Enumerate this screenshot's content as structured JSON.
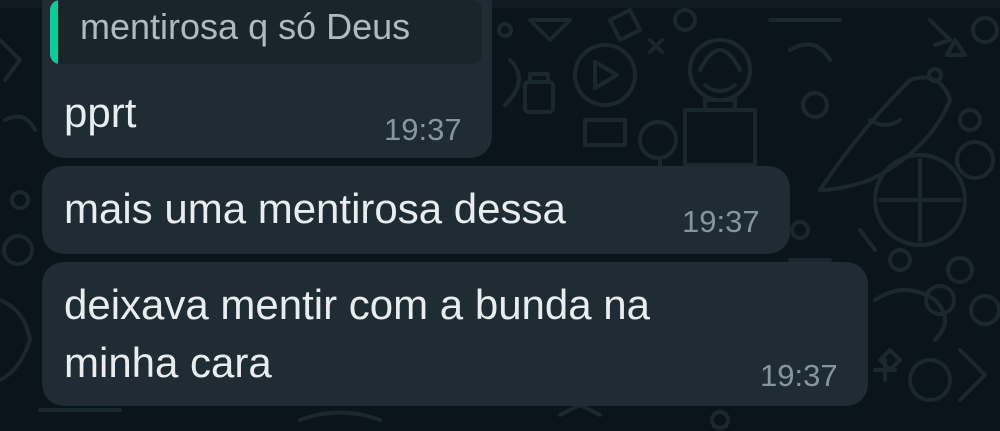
{
  "chat": {
    "messages": [
      {
        "quoted_text": "mentirosa q só Deus",
        "text": "pprt",
        "time": "19:37"
      },
      {
        "text": "mais uma mentirosa dessa",
        "time": "19:37"
      },
      {
        "line1": "deixava mentir com a bunda na",
        "line2": "minha cara",
        "time": "19:37"
      }
    ]
  },
  "colors": {
    "background": "#0b141a",
    "bubble": "#1f2c33",
    "quote_accent": "#06cf9c",
    "text": "#e9edef",
    "time": "#8696a0"
  }
}
